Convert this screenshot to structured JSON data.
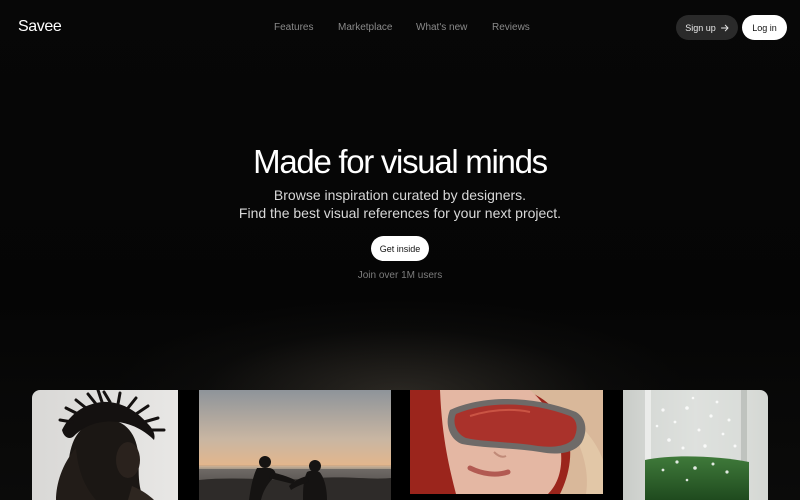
{
  "header": {
    "logo": "Savee",
    "nav": [
      "Features",
      "Marketplace",
      "What's new",
      "Reviews"
    ],
    "signup_label": "Sign up",
    "login_label": "Log in"
  },
  "hero": {
    "title": "Made for visual minds",
    "subtitle_line1": "Browse inspiration curated by designers.",
    "subtitle_line2": "Find the best visual references for your next project.",
    "cta_label": "Get inside",
    "users_note": "Join over 1M users"
  },
  "icons": {
    "signup_arrow": "arrow-right-icon"
  },
  "colors": {
    "background": "#000000",
    "nav_text": "#8a8a8a",
    "signup_bg": "#2a2a2a",
    "login_bg": "#ffffff",
    "note_text": "#7d7d7d"
  }
}
